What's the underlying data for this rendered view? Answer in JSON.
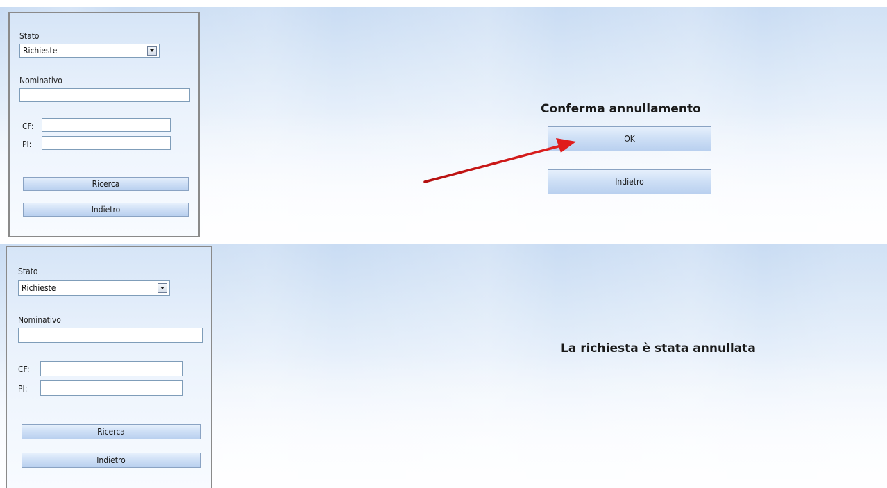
{
  "top": {
    "search": {
      "stato_label": "Stato",
      "stato_value": "Richieste",
      "nominativo_label": "Nominativo",
      "nominativo_value": "",
      "cf_label": "CF:",
      "cf_value": "",
      "pi_label": "PI:",
      "pi_value": "",
      "search_button": "Ricerca",
      "back_button": "Indietro"
    },
    "dialog": {
      "title": "Conferma annullamento",
      "ok_button": "OK",
      "back_button": "Indietro"
    },
    "annotation": {
      "arrow_color": "#d41a1a"
    }
  },
  "bottom": {
    "search": {
      "stato_label": "Stato",
      "stato_value": "Richieste",
      "nominativo_label": "Nominativo",
      "nominativo_value": "",
      "cf_label": "CF:",
      "cf_value": "",
      "pi_label": "PI:",
      "pi_value": "",
      "search_button": "Ricerca",
      "back_button": "Indietro"
    },
    "message": "La richiesta è stata annullata"
  }
}
